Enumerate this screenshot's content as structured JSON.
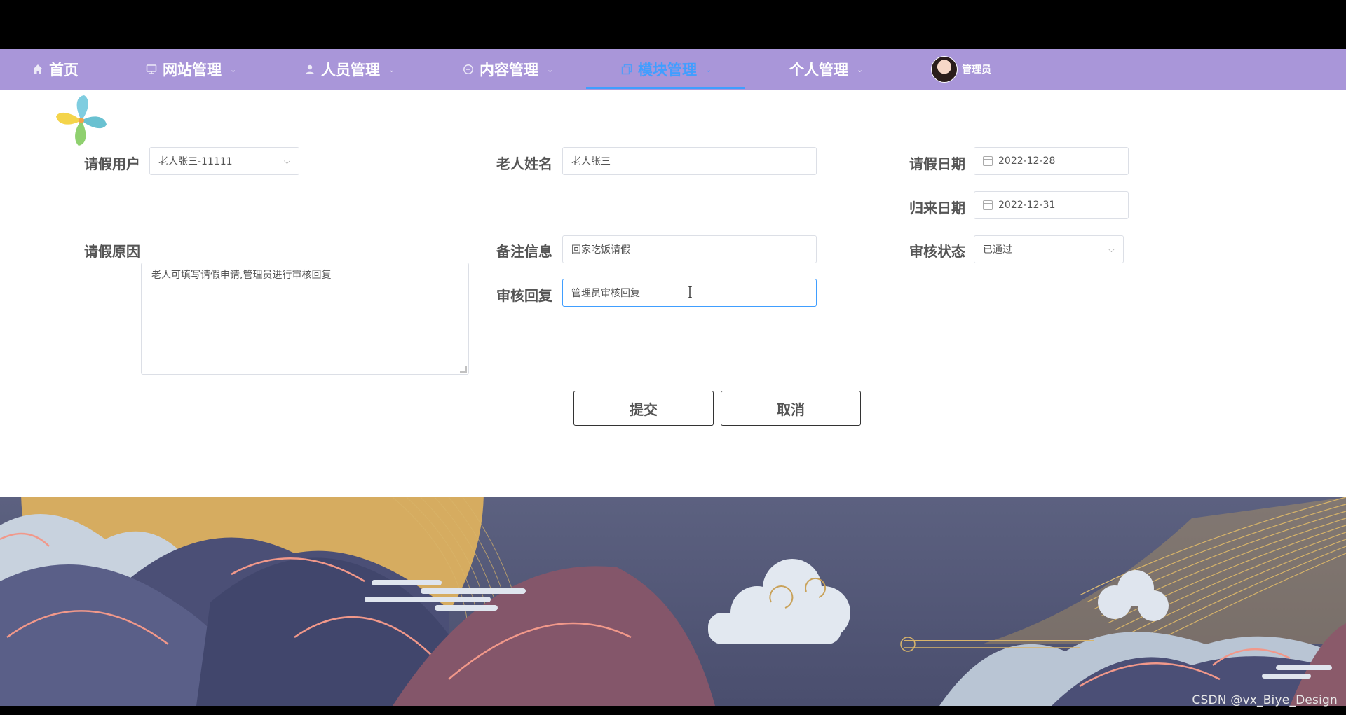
{
  "nav": {
    "items": [
      {
        "label": "首页",
        "icon": "home-icon"
      },
      {
        "label": "网站管理",
        "icon": "monitor-icon"
      },
      {
        "label": "人员管理",
        "icon": "user-icon"
      },
      {
        "label": "内容管理",
        "icon": "chat-icon"
      },
      {
        "label": "模块管理",
        "icon": "copy-icon"
      },
      {
        "label": "个人管理",
        "icon": ""
      }
    ],
    "active_index": 4,
    "user_label": "管理员"
  },
  "form": {
    "leave_user": {
      "label": "请假用户",
      "value": "老人张三-11111"
    },
    "elder_name": {
      "label": "老人姓名",
      "value": "老人张三"
    },
    "leave_date": {
      "label": "请假日期",
      "value": "2022-12-28"
    },
    "return_date": {
      "label": "归来日期",
      "value": "2022-12-31"
    },
    "leave_reason": {
      "label": "请假原因",
      "value": "老人可填写请假申请,管理员进行审核回复"
    },
    "remark": {
      "label": "备注信息",
      "value": "回家吃饭请假"
    },
    "review_status": {
      "label": "审核状态",
      "value": "已通过"
    },
    "review_reply": {
      "label": "审核回复",
      "value": "管理员审核回复"
    }
  },
  "buttons": {
    "submit": "提交",
    "cancel": "取消"
  },
  "watermark": "CSDN @vx_Biye_Design",
  "colors": {
    "nav_bg": "#a996d9",
    "accent": "#409eff"
  }
}
